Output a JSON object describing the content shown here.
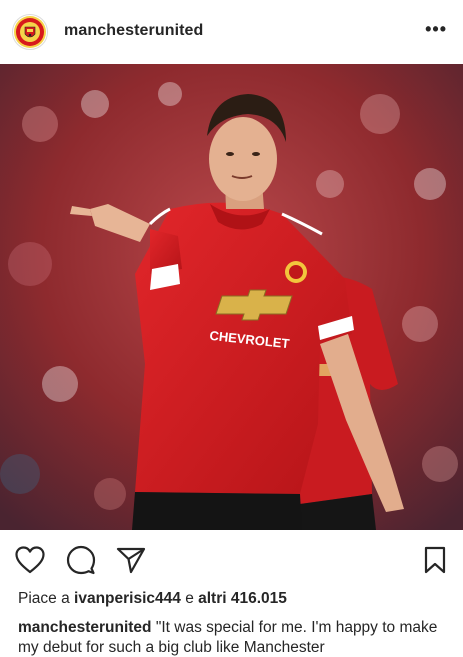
{
  "post": {
    "username": "manchesterunited",
    "more_label": "•••",
    "avatar_icon": "club-crest-icon",
    "photo_icon": "post-photo",
    "shirt_sponsor": "CHEVROLET"
  },
  "actions": {
    "like_icon": "heart-icon",
    "comment_icon": "comment-icon",
    "share_icon": "send-icon",
    "save_icon": "bookmark-icon"
  },
  "likes": {
    "prefix": "Piace a",
    "user": "ivanperisic444",
    "middle": "e",
    "count_text": "altri 416.015"
  },
  "caption": {
    "user": "manchesterunited",
    "text": "\"It was special for me. I'm happy to make my debut for such a big club like Manchester"
  },
  "colors": {
    "text": "#262626",
    "jersey_red": "#d7191c",
    "border": "#dbdbdb"
  }
}
